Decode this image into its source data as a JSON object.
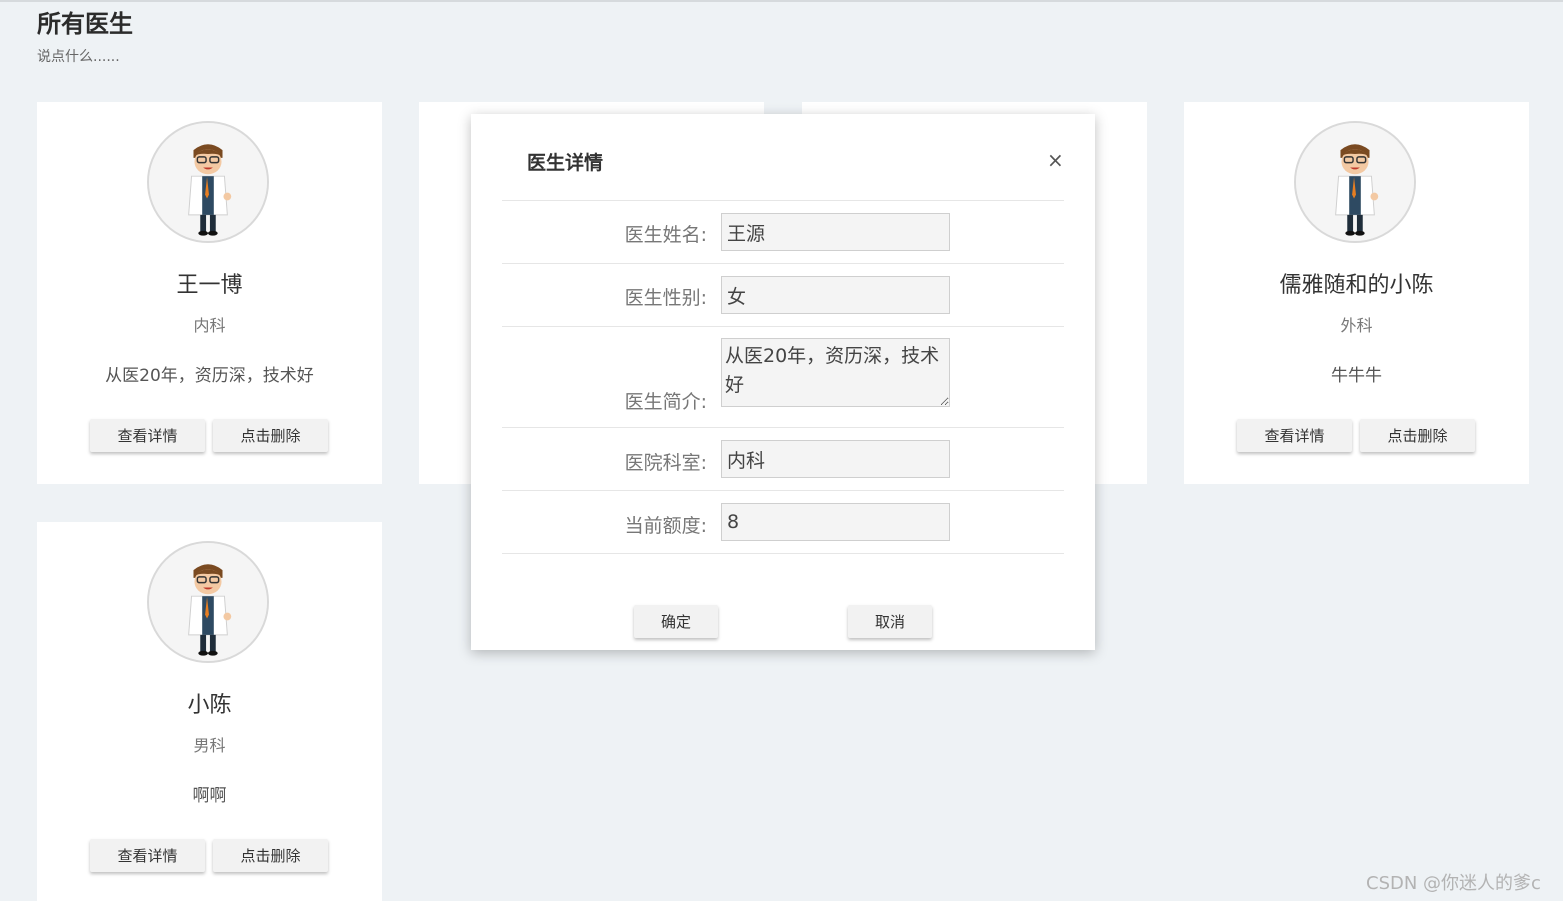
{
  "page": {
    "title": "所有医生",
    "subtitle": "说点什么......"
  },
  "doctors": [
    {
      "name": "王一博",
      "dept": "内科",
      "intro": "从医20年，资历深，技术好",
      "detail_label": "查看详情",
      "delete_label": "点击删除"
    },
    {
      "name": "",
      "dept": "",
      "intro": "",
      "detail_label": "",
      "delete_label": ""
    },
    {
      "name": "",
      "dept": "",
      "intro": "",
      "detail_label": "",
      "delete_label": ""
    },
    {
      "name": "儒雅随和的小陈",
      "dept": "外科",
      "intro": "牛牛牛",
      "detail_label": "查看详情",
      "delete_label": "点击删除"
    },
    {
      "name": "小陈",
      "dept": "男科",
      "intro": "啊啊",
      "detail_label": "查看详情",
      "delete_label": "点击删除"
    }
  ],
  "modal": {
    "title": "医生详情",
    "close_icon": "×",
    "fields": {
      "name": {
        "label": "医生姓名:",
        "value": "王源"
      },
      "gender": {
        "label": "医生性别:",
        "value": "女"
      },
      "intro": {
        "label": "医生简介:",
        "value": "从医20年，资历深，技术好"
      },
      "dept": {
        "label": "医院科室:",
        "value": "内科"
      },
      "quota": {
        "label": "当前额度:",
        "value": "8"
      }
    },
    "confirm_label": "确定",
    "cancel_label": "取消"
  },
  "watermark": "CSDN @你迷人的爹c",
  "icons": {
    "avatar": "doctor-avatar-icon",
    "close": "close-icon"
  }
}
